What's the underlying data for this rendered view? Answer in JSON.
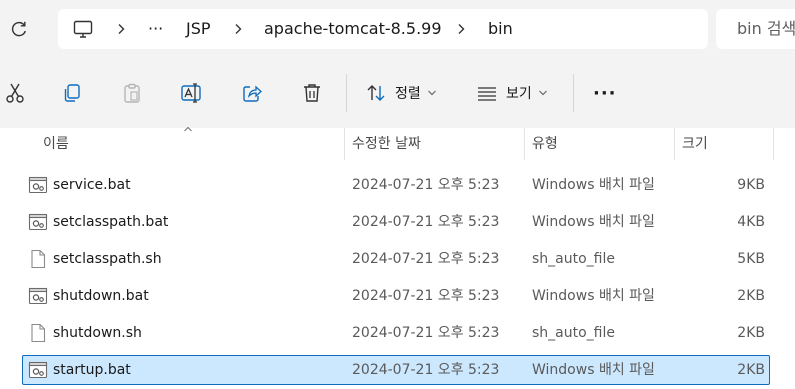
{
  "address": {
    "overflow": "···",
    "crumbs": [
      "JSP",
      "apache-tomcat-8.5.99",
      "bin"
    ],
    "search_placeholder": "bin 검색"
  },
  "toolbar": {
    "sort_label": "정렬",
    "view_label": "보기",
    "more_label": "···"
  },
  "columns": {
    "name": "이름",
    "date": "수정한 날짜",
    "type": "유형",
    "size": "크기"
  },
  "files": [
    {
      "name": "service.bat",
      "date": "2024-07-21 오후 5:23",
      "type": "Windows 배치 파일",
      "size": "9KB",
      "icon": "batch-file-icon",
      "selected": false
    },
    {
      "name": "setclasspath.bat",
      "date": "2024-07-21 오후 5:23",
      "type": "Windows 배치 파일",
      "size": "4KB",
      "icon": "batch-file-icon",
      "selected": false
    },
    {
      "name": "setclasspath.sh",
      "date": "2024-07-21 오후 5:23",
      "type": "sh_auto_file",
      "size": "5KB",
      "icon": "blank-file-icon",
      "selected": false
    },
    {
      "name": "shutdown.bat",
      "date": "2024-07-21 오후 5:23",
      "type": "Windows 배치 파일",
      "size": "2KB",
      "icon": "batch-file-icon",
      "selected": false
    },
    {
      "name": "shutdown.sh",
      "date": "2024-07-21 오후 5:23",
      "type": "sh_auto_file",
      "size": "2KB",
      "icon": "blank-file-icon",
      "selected": false
    },
    {
      "name": "startup.bat",
      "date": "2024-07-21 오후 5:23",
      "type": "Windows 배치 파일",
      "size": "2KB",
      "icon": "batch-file-icon",
      "selected": true
    }
  ],
  "colors": {
    "selection_bg": "#cce8ff",
    "selection_border": "#0f6cbd",
    "chrome_bg": "#f3f3f3"
  }
}
